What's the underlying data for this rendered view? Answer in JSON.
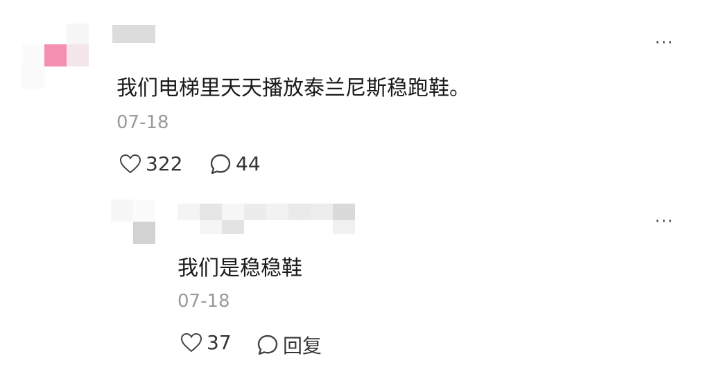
{
  "comments": [
    {
      "text": "我们电梯里天天播放泰兰尼斯稳跑鞋。",
      "date": "07-18",
      "like_count": "322",
      "reply_count": "44",
      "accent_color": "#f48fb1"
    }
  ],
  "replies": [
    {
      "text": "我们是稳稳鞋",
      "date": "07-18",
      "like_count": "37",
      "reply_label": "回复"
    }
  ],
  "icons": {
    "more": "more-horizontal-icon",
    "like": "heart-outline-icon",
    "comment": "comment-bubble-icon"
  },
  "more_glyph": "···"
}
